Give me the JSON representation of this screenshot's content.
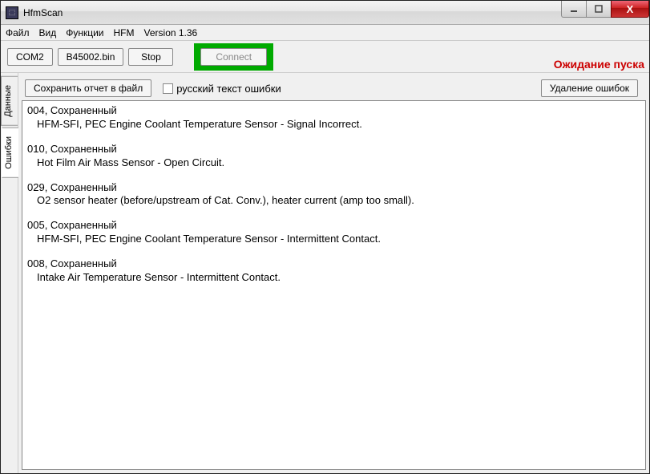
{
  "window": {
    "title": "HfmScan"
  },
  "menu": {
    "file": "Файл",
    "view": "Вид",
    "functions": "Функции",
    "hfm": "HFM",
    "version": "Version 1.36"
  },
  "toolbar": {
    "com": "COM2",
    "file": "B45002.bin",
    "stop": "Stop",
    "connect": "Connect",
    "status": "Ожидание пуска"
  },
  "side": {
    "tab_data": "Данные",
    "tab_errors": "Ошибки"
  },
  "panel": {
    "save_report": "Сохранить отчет в файл",
    "russian_errors": "русский текст ошибки",
    "delete_errors": "Удаление ошибок"
  },
  "errors": [
    {
      "code": "004,  Сохраненный",
      "desc": "HFM-SFI, PEC Engine Coolant Temperature Sensor - Signal Incorrect."
    },
    {
      "code": "010,  Сохраненный",
      "desc": "Hot Film Air Mass Sensor - Open Circuit."
    },
    {
      "code": "029,  Сохраненный",
      "desc": "O2 sensor heater (before/upstream of Cat. Conv.), heater current (amp too small)."
    },
    {
      "code": "005,  Сохраненный",
      "desc": "HFM-SFI, PEC Engine Coolant Temperature Sensor - Intermittent Contact."
    },
    {
      "code": "008,  Сохраненный",
      "desc": "Intake Air Temperature Sensor - Intermittent Contact."
    }
  ]
}
